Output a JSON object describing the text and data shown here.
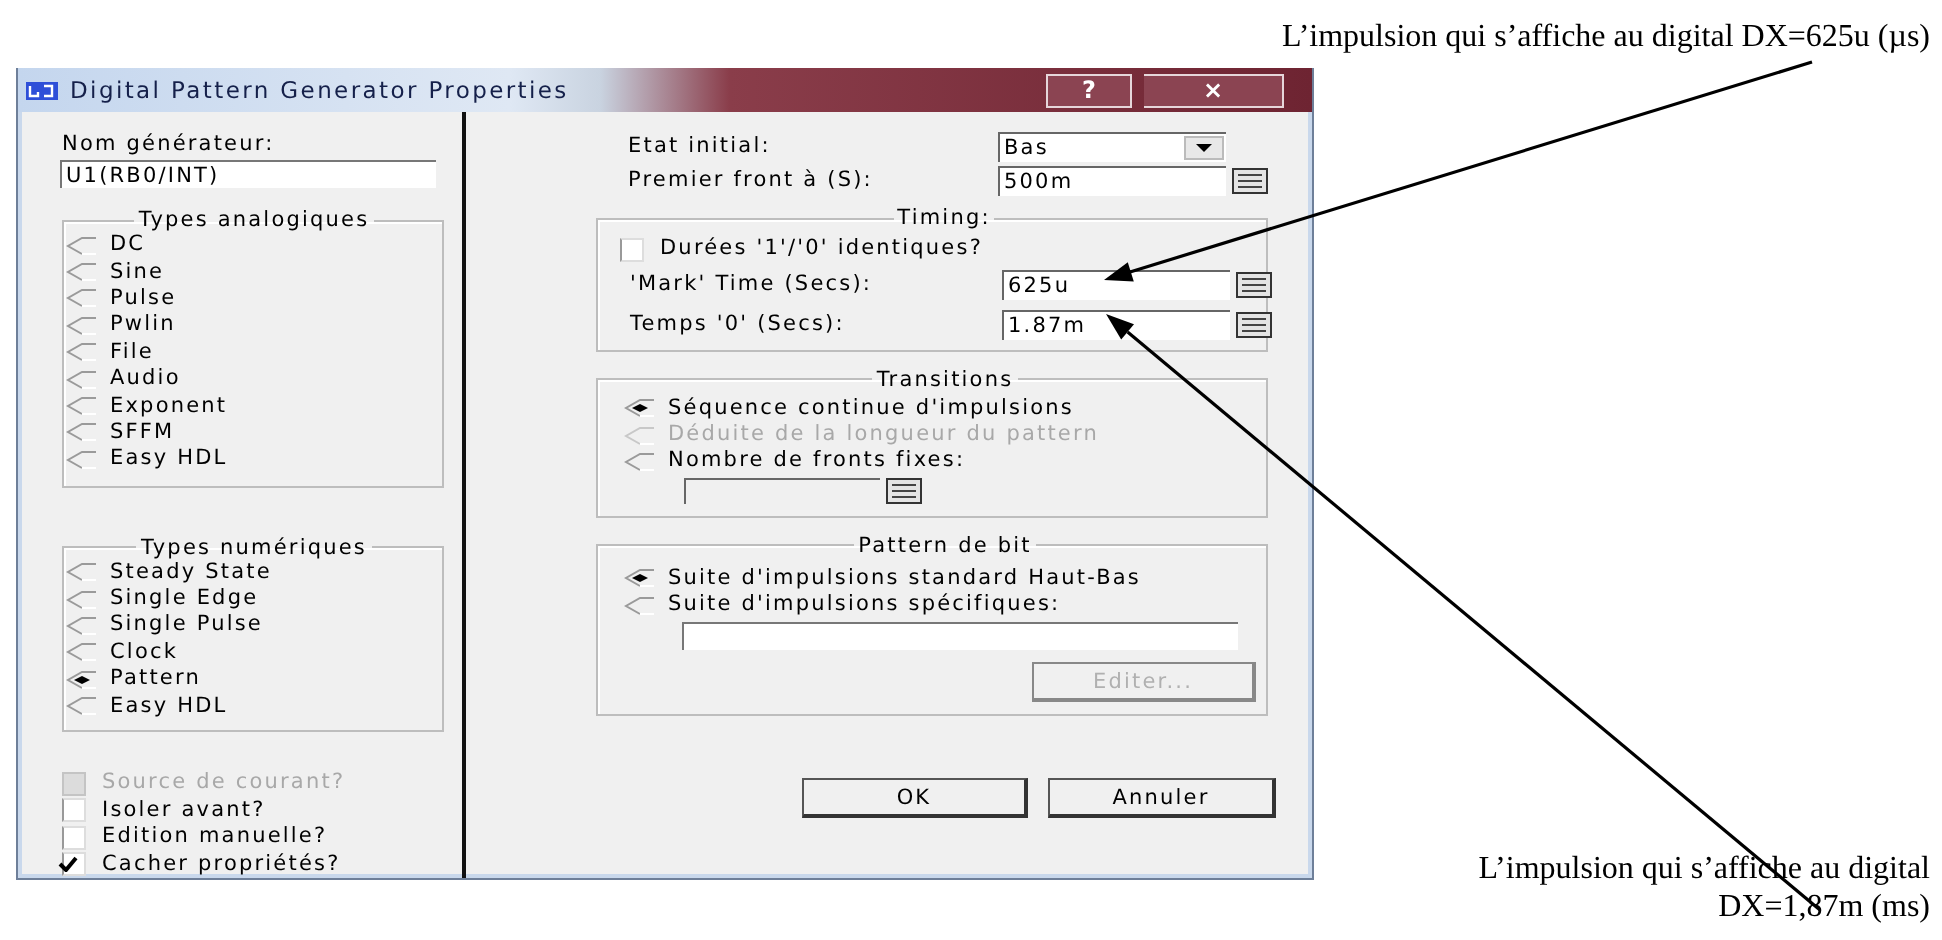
{
  "window": {
    "title": "Digital Pattern Generator Properties",
    "help_button": "?",
    "close_button": "×"
  },
  "generator": {
    "label": "Nom générateur:",
    "value": "U1(RB0/INT)"
  },
  "analog_types": {
    "title": "Types analogiques",
    "options": [
      {
        "label": "DC",
        "selected": false
      },
      {
        "label": "Sine",
        "selected": false
      },
      {
        "label": "Pulse",
        "selected": false
      },
      {
        "label": "Pwlin",
        "selected": false
      },
      {
        "label": "File",
        "selected": false
      },
      {
        "label": "Audio",
        "selected": false
      },
      {
        "label": "Exponent",
        "selected": false
      },
      {
        "label": "SFFM",
        "selected": false
      },
      {
        "label": "Easy HDL",
        "selected": false
      }
    ]
  },
  "digital_types": {
    "title": "Types numériques",
    "options": [
      {
        "label": "Steady State",
        "selected": false
      },
      {
        "label": "Single Edge",
        "selected": false
      },
      {
        "label": "Single Pulse",
        "selected": false
      },
      {
        "label": "Clock",
        "selected": false
      },
      {
        "label": "Pattern",
        "selected": true
      },
      {
        "label": "Easy HDL",
        "selected": false
      }
    ]
  },
  "checkboxes": [
    {
      "label": "Source de courant?",
      "checked": false,
      "disabled": true
    },
    {
      "label": "Isoler avant?",
      "checked": false,
      "disabled": false
    },
    {
      "label": "Edition manuelle?",
      "checked": false,
      "disabled": false
    },
    {
      "label": "Cacher propriétés?",
      "checked": true,
      "disabled": false
    }
  ],
  "initial_state": {
    "label": "Etat initial:",
    "value": "Bas"
  },
  "first_edge": {
    "label": "Premier front à (S):",
    "value": "500m"
  },
  "timing": {
    "title": "Timing:",
    "same_durations": {
      "label": "Durées '1'/'0' identiques?",
      "checked": false
    },
    "fields": [
      {
        "label": "'Mark' Time (Secs):",
        "value": "625u"
      },
      {
        "label": "Temps '0' (Secs):",
        "value": "1.87m"
      }
    ]
  },
  "transitions": {
    "title": "Transitions",
    "options": [
      {
        "label": "Séquence continue d'impulsions",
        "selected": true,
        "disabled": false
      },
      {
        "label": "Déduite de la longueur du pattern",
        "selected": false,
        "disabled": true
      },
      {
        "label": "Nombre de fronts fixes:",
        "selected": false,
        "disabled": false
      }
    ]
  },
  "bit_pattern": {
    "title": "Pattern de bit",
    "options": [
      {
        "label": "Suite d'impulsions standard Haut-Bas",
        "selected": true
      },
      {
        "label": "Suite d'impulsions spécifiques:",
        "selected": false
      }
    ],
    "edit_button": {
      "label": "Editer...",
      "disabled": true
    }
  },
  "buttons": [
    "OK",
    "Annuler"
  ],
  "annotations": [
    {
      "text": "L’impulsion qui s’affiche au digital DX=625u (µs)"
    },
    {
      "text": "L’impulsion qui s’affiche au digital DX=1,87m (ms)"
    }
  ]
}
